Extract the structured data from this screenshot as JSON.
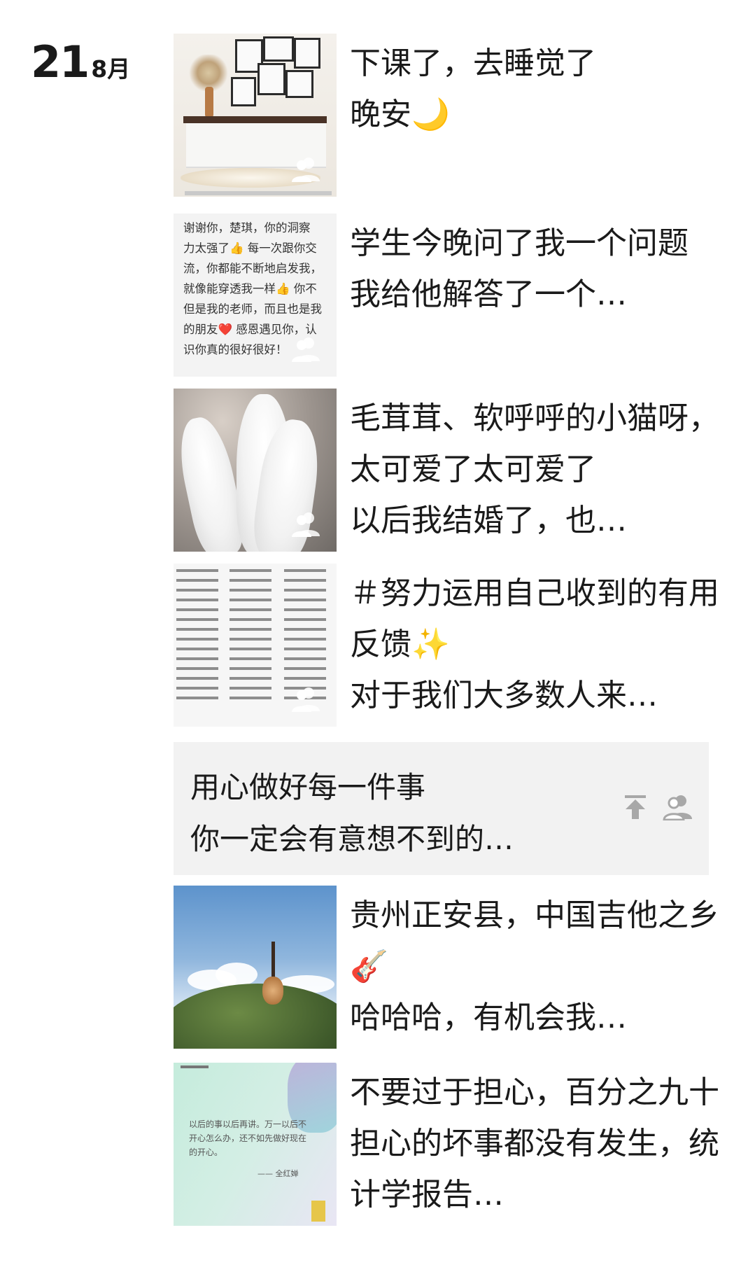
{
  "date": {
    "day": "21",
    "month": "8月"
  },
  "posts": [
    {
      "text": "下课了，去睡觉了\n晚安🌙"
    },
    {
      "text": "学生今晚问了我一个问题\n我给他解答了一个…",
      "thumb_text": [
        "谢谢你，楚琪，你的洞察",
        "力太强了👍 每一次跟你交",
        "流，你都能不断地启发我，",
        "就像能穿透我一样👍 你不",
        "但是我的老师，而且也是我",
        "的朋友❤️ 感恩遇见你，认",
        "识你真的很好很好！"
      ]
    },
    {
      "text": "毛茸茸、软呼呼的小猫呀，太可爱了太可爱了\n以后我结婚了，也…"
    },
    {
      "text": "＃努力运用自己收到的有用反馈✨\n对于我们大多数人来…"
    },
    {
      "text": "贵州正安县，中国吉他之乡🎸\n哈哈哈，有机会我…"
    },
    {
      "text": "不要过于担心，百分之九十担心的坏事都没有发生，统计学报告…",
      "thumb_quote": "以后的事以后再讲。万一以后不开心怎么办，还不如先做好现在的开心。",
      "thumb_author": "—— 全红婵"
    }
  ],
  "text_post": {
    "text": "用心做好每一件事\n你一定会有意想不到的…"
  },
  "icons": {
    "friends": "friends-visible-icon",
    "pin": "pin-top-icon"
  }
}
